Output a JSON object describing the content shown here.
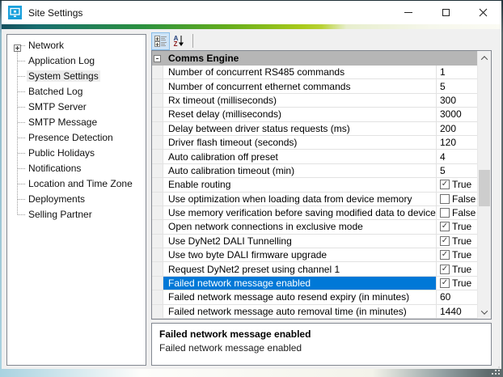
{
  "window": {
    "title": "Site Settings",
    "controls": {
      "minimize": "minimize",
      "maximize": "maximize",
      "close": "close"
    }
  },
  "colors": {
    "selection_accent": "#0078d7",
    "category_header_bg": "#b6b6b6",
    "titlebar_bg": "#ffffff",
    "brand_gradient": [
      "#14505e",
      "#2b9140",
      "#a9ca1b",
      "#f6f7ec"
    ],
    "toolbar_active_bg": "#cfe4f7"
  },
  "icons": {
    "app": "monitor-icon",
    "toolbar": [
      "categorized-icon",
      "sort-alphabetical-icon"
    ],
    "tree_expander": "plus-box-icon",
    "category_collapse": "minus-box-icon"
  },
  "glyphs": {
    "check": "✓"
  },
  "sidebar": {
    "items": [
      {
        "label": "Network",
        "expandable": true,
        "selected": false
      },
      {
        "label": "Application Log",
        "expandable": false,
        "selected": false
      },
      {
        "label": "System Settings",
        "expandable": false,
        "selected": true
      },
      {
        "label": "Batched Log",
        "expandable": false,
        "selected": false
      },
      {
        "label": "SMTP Server",
        "expandable": false,
        "selected": false
      },
      {
        "label": "SMTP Message",
        "expandable": false,
        "selected": false
      },
      {
        "label": "Presence Detection",
        "expandable": false,
        "selected": false
      },
      {
        "label": "Public Holidays",
        "expandable": false,
        "selected": false
      },
      {
        "label": "Notifications",
        "expandable": false,
        "selected": false
      },
      {
        "label": "Location and Time Zone",
        "expandable": false,
        "selected": false
      },
      {
        "label": "Deployments",
        "expandable": false,
        "selected": false
      },
      {
        "label": "Selling Partner",
        "expandable": false,
        "selected": false
      }
    ]
  },
  "property_grid": {
    "category": "Comms Engine",
    "rows": [
      {
        "name": "Number of concurrent RS485 commands",
        "value": "1",
        "type": "text"
      },
      {
        "name": "Number of concurrent ethernet commands",
        "value": "5",
        "type": "text"
      },
      {
        "name": "Rx timeout (milliseconds)",
        "value": "300",
        "type": "text"
      },
      {
        "name": "Reset delay (milliseconds)",
        "value": "3000",
        "type": "text"
      },
      {
        "name": "Delay between driver status requests (ms)",
        "value": "200",
        "type": "text"
      },
      {
        "name": "Driver flash timeout (seconds)",
        "value": "120",
        "type": "text"
      },
      {
        "name": "Auto calibration off preset",
        "value": "4",
        "type": "text"
      },
      {
        "name": "Auto calibration timeout (min)",
        "value": "5",
        "type": "text"
      },
      {
        "name": "Enable routing",
        "value": "True",
        "type": "checkbox",
        "checked": true
      },
      {
        "name": "Use optimization when loading data from device memory",
        "value": "False",
        "type": "checkbox",
        "checked": false
      },
      {
        "name": "Use memory verification before saving modified data to device",
        "value": "False",
        "type": "checkbox",
        "checked": false
      },
      {
        "name": "Open network connections in exclusive mode",
        "value": "True",
        "type": "checkbox",
        "checked": true
      },
      {
        "name": "Use DyNet2 DALI Tunnelling",
        "value": "True",
        "type": "checkbox",
        "checked": true
      },
      {
        "name": "Use two byte DALI firmware upgrade",
        "value": "True",
        "type": "checkbox",
        "checked": true
      },
      {
        "name": "Request DyNet2 preset using channel 1",
        "value": "True",
        "type": "checkbox",
        "checked": true
      },
      {
        "name": "Failed network message enabled",
        "value": "True",
        "type": "checkbox",
        "checked": true,
        "selected": true
      },
      {
        "name": "Failed network message auto resend expiry (in minutes)",
        "value": "60",
        "type": "text"
      },
      {
        "name": "Failed network message auto removal time (in minutes)",
        "value": "1440",
        "type": "text"
      }
    ]
  },
  "description": {
    "title": "Failed network message enabled",
    "text": "Failed network message enabled"
  }
}
